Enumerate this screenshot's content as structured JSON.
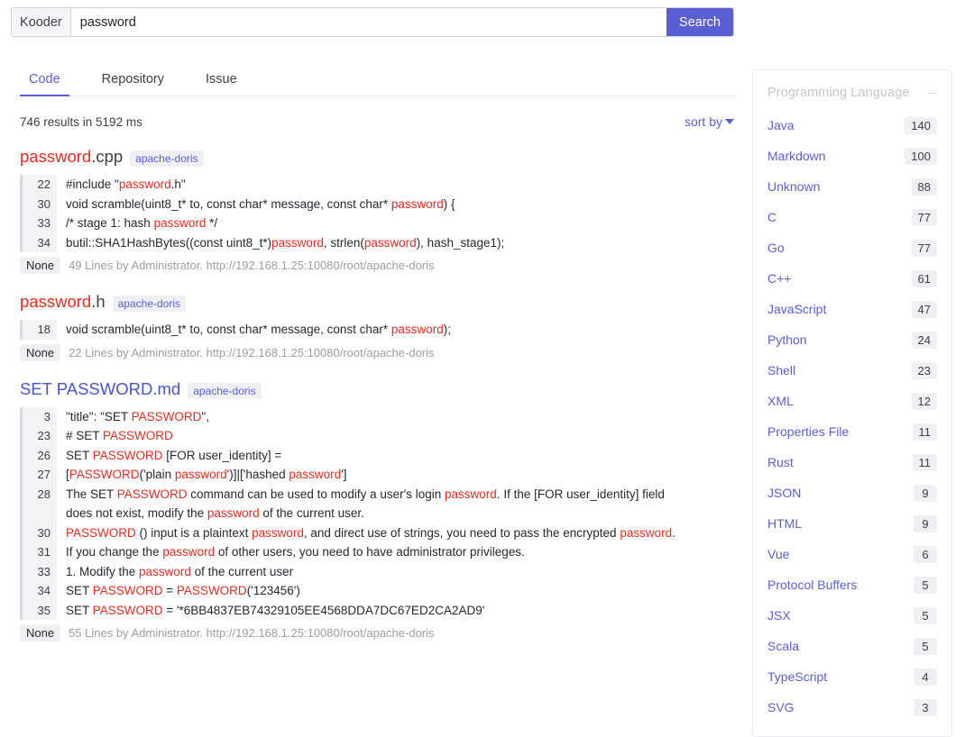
{
  "search": {
    "brand": "Kooder",
    "query": "password",
    "placeholder": "Search",
    "button_label": "Search",
    "accent_color": "#5a5fd4"
  },
  "tabs": [
    {
      "label": "Code",
      "active": true
    },
    {
      "label": "Repository",
      "active": false
    },
    {
      "label": "Issue",
      "active": false
    }
  ],
  "results_summary": "746 results in 5192 ms",
  "sort": {
    "label": "sort by"
  },
  "facets": {
    "title": "Programming Language",
    "items": [
      {
        "label": "Java",
        "count": "140"
      },
      {
        "label": "Markdown",
        "count": "100"
      },
      {
        "label": "Unknown",
        "count": "88"
      },
      {
        "label": "C",
        "count": "77"
      },
      {
        "label": "Go",
        "count": "77"
      },
      {
        "label": "C++",
        "count": "61"
      },
      {
        "label": "JavaScript",
        "count": "47"
      },
      {
        "label": "Python",
        "count": "24"
      },
      {
        "label": "Shell",
        "count": "23"
      },
      {
        "label": "XML",
        "count": "12"
      },
      {
        "label": "Properties File",
        "count": "11"
      },
      {
        "label": "Rust",
        "count": "11"
      },
      {
        "label": "JSON",
        "count": "9"
      },
      {
        "label": "HTML",
        "count": "9"
      },
      {
        "label": "Vue",
        "count": "6"
      },
      {
        "label": "Protocol Buffers",
        "count": "5"
      },
      {
        "label": "JSX",
        "count": "5"
      },
      {
        "label": "Scala",
        "count": "5"
      },
      {
        "label": "TypeScript",
        "count": "4"
      },
      {
        "label": "SVG",
        "count": "3"
      }
    ]
  },
  "results": [
    {
      "title_parts": [
        {
          "t": "password",
          "hl": true
        },
        {
          "t": ".cpp",
          "hl": false
        }
      ],
      "title_color": "red",
      "repo": "apache-doris",
      "lines": [
        {
          "no": "22",
          "parts": [
            {
              "t": "#include \"",
              "hl": false
            },
            {
              "t": "password",
              "hl": true
            },
            {
              "t": ".h\"",
              "hl": false
            }
          ]
        },
        {
          "no": "30",
          "parts": [
            {
              "t": "void scramble(uint8_t* to, const char* message, const char* ",
              "hl": false
            },
            {
              "t": "password",
              "hl": true
            },
            {
              "t": ") {",
              "hl": false
            }
          ]
        },
        {
          "no": "33",
          "parts": [
            {
              "t": "/* stage 1: hash ",
              "hl": false
            },
            {
              "t": "password",
              "hl": true
            },
            {
              "t": " */",
              "hl": false
            }
          ]
        },
        {
          "no": "34",
          "parts": [
            {
              "t": "butil::SHA1HashBytes((const uint8_t*)",
              "hl": false
            },
            {
              "t": "password",
              "hl": true
            },
            {
              "t": ", strlen(",
              "hl": false
            },
            {
              "t": "password",
              "hl": true
            },
            {
              "t": "), hash_stage1);",
              "hl": false
            }
          ]
        }
      ],
      "lang": "None",
      "meta": "49 Lines by Administrator. http://192.168.1.25:10080/root/apache-doris"
    },
    {
      "title_parts": [
        {
          "t": "password",
          "hl": true
        },
        {
          "t": ".h",
          "hl": false
        }
      ],
      "title_color": "red",
      "repo": "apache-doris",
      "lines": [
        {
          "no": "18",
          "parts": [
            {
              "t": "void scramble(uint8_t* to, const char* message, const char* ",
              "hl": false
            },
            {
              "t": "password",
              "hl": true
            },
            {
              "t": ");",
              "hl": false
            }
          ]
        }
      ],
      "lang": "None",
      "meta": "22 Lines by Administrator. http://192.168.1.25:10080/root/apache-doris"
    },
    {
      "title_parts": [
        {
          "t": "SET PASSWORD.md",
          "hl": false
        }
      ],
      "title_color": "blue",
      "repo": "apache-doris",
      "lines": [
        {
          "no": "3",
          "parts": [
            {
              "t": "\"title\": \"SET ",
              "hl": false
            },
            {
              "t": "PASSWORD",
              "hl": true
            },
            {
              "t": "\",",
              "hl": false
            }
          ]
        },
        {
          "no": "23",
          "parts": [
            {
              "t": "# SET ",
              "hl": false
            },
            {
              "t": "PASSWORD",
              "hl": true
            }
          ]
        },
        {
          "no": "26",
          "parts": [
            {
              "t": "SET ",
              "hl": false
            },
            {
              "t": "PASSWORD",
              "hl": true
            },
            {
              "t": " [FOR user_identity] =",
              "hl": false
            }
          ]
        },
        {
          "no": "27",
          "parts": [
            {
              "t": "[",
              "hl": false
            },
            {
              "t": "PASSWORD",
              "hl": true
            },
            {
              "t": "('plain ",
              "hl": false
            },
            {
              "t": "password",
              "hl": true
            },
            {
              "t": "')]|['hashed ",
              "hl": false
            },
            {
              "t": "password",
              "hl": true
            },
            {
              "t": "']",
              "hl": false
            }
          ]
        },
        {
          "no": "28",
          "parts": [
            {
              "t": "The SET ",
              "hl": false
            },
            {
              "t": "PASSWORD",
              "hl": true
            },
            {
              "t": " command can be used to modify a user's login ",
              "hl": false
            },
            {
              "t": "password",
              "hl": true
            },
            {
              "t": ". If the [FOR user_identity] field does not exist, modify the ",
              "hl": false
            },
            {
              "t": "password",
              "hl": true
            },
            {
              "t": " of the current user.",
              "hl": false
            }
          ]
        },
        {
          "no": "30",
          "parts": [
            {
              "t": "PASSWORD",
              "hl": true
            },
            {
              "t": " () input is a plaintext ",
              "hl": false
            },
            {
              "t": "password",
              "hl": true
            },
            {
              "t": ", and direct use of strings, you need to pass the encrypted ",
              "hl": false
            },
            {
              "t": "password",
              "hl": true
            },
            {
              "t": ".",
              "hl": false
            }
          ]
        },
        {
          "no": "31",
          "parts": [
            {
              "t": "If you change the ",
              "hl": false
            },
            {
              "t": "password",
              "hl": true
            },
            {
              "t": " of other users, you need to have administrator privileges.",
              "hl": false
            }
          ]
        },
        {
          "no": "33",
          "parts": [
            {
              "t": "1. Modify the ",
              "hl": false
            },
            {
              "t": "password",
              "hl": true
            },
            {
              "t": " of the current user",
              "hl": false
            }
          ]
        },
        {
          "no": "34",
          "parts": [
            {
              "t": "SET ",
              "hl": false
            },
            {
              "t": "PASSWORD",
              "hl": true
            },
            {
              "t": " = ",
              "hl": false
            },
            {
              "t": "PASSWORD",
              "hl": true
            },
            {
              "t": "('123456')",
              "hl": false
            }
          ]
        },
        {
          "no": "35",
          "parts": [
            {
              "t": "SET ",
              "hl": false
            },
            {
              "t": "PASSWORD",
              "hl": true
            },
            {
              "t": " = '*6BB4837EB74329105EE4568DDA7DC67ED2CA2AD9'",
              "hl": false
            }
          ]
        }
      ],
      "lang": "None",
      "meta": "55 Lines by Administrator. http://192.168.1.25:10080/root/apache-doris"
    }
  ]
}
